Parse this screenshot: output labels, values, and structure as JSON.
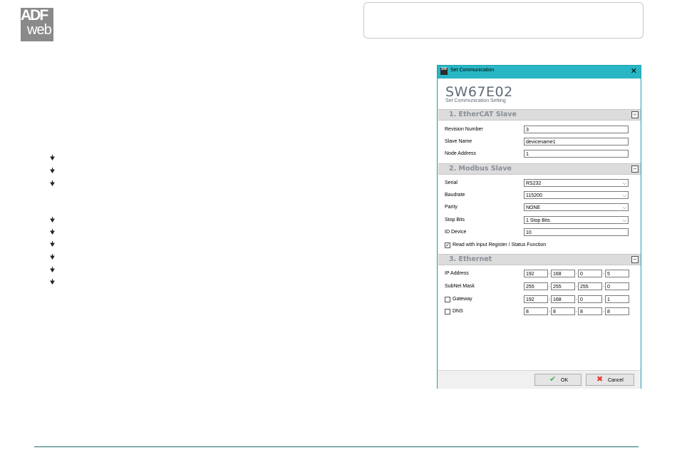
{
  "logo": {
    "line1": "ADF",
    "line2": "web"
  },
  "dialog": {
    "window_title": "Set Communication",
    "app_icon_text": "SW",
    "close_glyph": "✕",
    "title": "SW67E02",
    "subtitle": "Set Communication Setting",
    "sections": {
      "ethercat": {
        "title": "1. EtherCAT Slave",
        "revision_label": "Revision Number",
        "revision_value": "3",
        "slave_name_label": "Slave Name",
        "slave_name_value": "devicename1",
        "node_address_label": "Node Address",
        "node_address_value": "1"
      },
      "modbus": {
        "title": "2. Modbus Slave",
        "serial_label": "Serial",
        "serial_value": "RS232",
        "baudrate_label": "Baudrate",
        "baudrate_value": "115200",
        "parity_label": "Parity",
        "parity_value": "NONE",
        "stopbits_label": "Stop Bits",
        "stopbits_value": "1 Stop Bits",
        "id_device_label": "ID Device",
        "id_device_value": "10",
        "read_input_label": "Read with Input Register / Status Function",
        "read_input_checked": true
      },
      "ethernet": {
        "title": "3. Ethernet",
        "ip_label": "IP Address",
        "ip": [
          "192",
          "168",
          "0",
          "5"
        ],
        "mask_label": "SubNet Mask",
        "mask": [
          "255",
          "255",
          "255",
          "0"
        ],
        "gateway_label": "Gateway",
        "gateway": [
          "192",
          "168",
          "0",
          "1"
        ],
        "gateway_checked": false,
        "dns_label": "DNS",
        "dns": [
          "8",
          "8",
          "8",
          "8"
        ],
        "dns_checked": false
      }
    },
    "ok_label": "OK",
    "cancel_label": "Cancel"
  },
  "colors": {
    "titlebar": "#28b6c4",
    "footer_line": "#1f6b6b"
  }
}
